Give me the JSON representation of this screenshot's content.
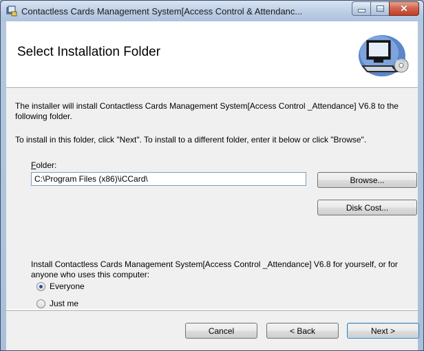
{
  "window": {
    "title": "Contactless Cards Management System[Access Control & Attendanc..."
  },
  "banner": {
    "title": "Select Installation Folder"
  },
  "content": {
    "paragraph1": "The installer will install Contactless Cards Management System[Access Control _Attendance] V6.8 to the following folder.",
    "paragraph2": "To install in this folder, click \"Next\". To install to a different folder, enter it below or click \"Browse\".",
    "folder_label_mnemonic": "F",
    "folder_label_rest": "older:",
    "folder_value": "C:\\Program Files (x86)\\iCCard\\",
    "browse_label": "Browse...",
    "disk_cost_label": "Disk Cost...",
    "paragraph3": "Install Contactless Cards Management System[Access Control _Attendance] V6.8 for yourself, or for anyone who uses this computer:",
    "radio_options": [
      {
        "label": "Everyone",
        "selected": true
      },
      {
        "label": "Just me",
        "selected": false
      }
    ]
  },
  "footer": {
    "cancel_label": "Cancel",
    "back_label": "< Back",
    "next_label": "Next >"
  },
  "icons": [
    "installer-app-icon",
    "minimize-icon",
    "maximize-icon",
    "close-icon",
    "computer-cd-graphic"
  ]
}
